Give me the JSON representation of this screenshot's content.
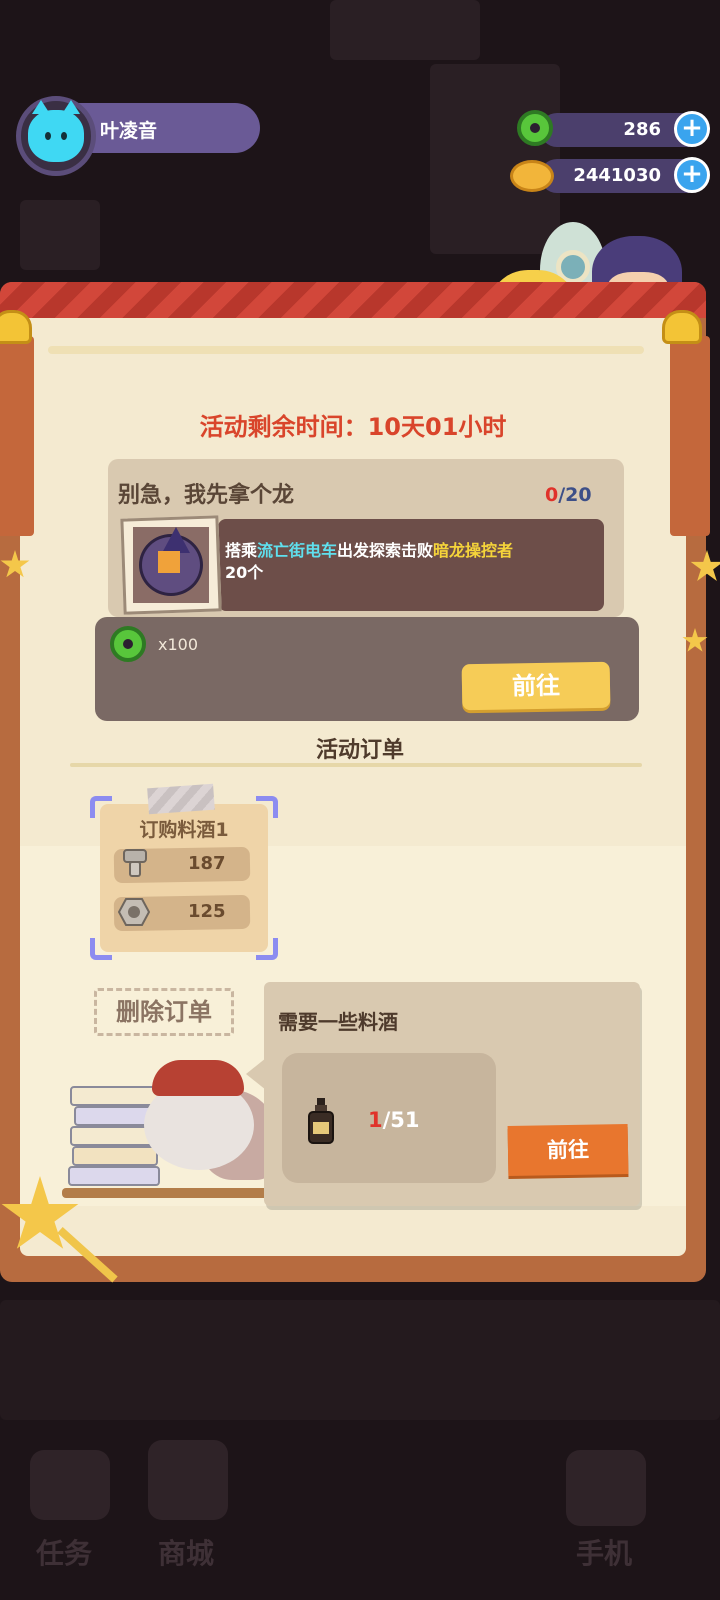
{
  "player": {
    "name": "叶凌音"
  },
  "resources": {
    "donut_amount": "286",
    "coin_amount": "2441030"
  },
  "event": {
    "timer": "活动剩余时间：10天01小时"
  },
  "task": {
    "title": "别急，我先拿个龙",
    "progress_current": "0",
    "progress_total": "/20",
    "desc_prefix": "搭乘",
    "desc_place": "流亡街电车",
    "desc_middle": "出发探索击败",
    "desc_enemy": "暗龙操控者",
    "desc_suffix": "20个",
    "reward_qty": "x100",
    "goto_label": "前往"
  },
  "orders": {
    "section_title": "活动订单",
    "card": {
      "title": "订购料酒1",
      "rows": [
        {
          "icon": "bolt-icon",
          "value": "187"
        },
        {
          "icon": "nut-icon",
          "value": "125"
        }
      ]
    },
    "delete_label": "删除订单"
  },
  "tooltip": {
    "title": "需要一些料酒",
    "item_icon": "cooking-wine-bottle-icon",
    "progress_current": "1",
    "progress_total": "/51",
    "goto_label": "前往"
  },
  "bottom_nav": {
    "items": [
      {
        "label": "任务",
        "icon": "task-icon"
      },
      {
        "label": "商城",
        "icon": "shop-icon"
      },
      {
        "label": "手机",
        "icon": "phone-icon"
      }
    ]
  },
  "colors": {
    "accent_red": "#d9452b",
    "highlight_cyan": "#5fe0ee",
    "highlight_yellow": "#f5d43a",
    "goto_yellow": "#f6cc57",
    "goto_orange": "#e8762e"
  }
}
